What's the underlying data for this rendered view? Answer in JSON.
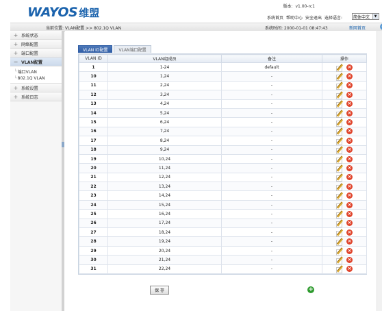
{
  "brand": {
    "logo_en": "WAYOS",
    "logo_cn": "维盟"
  },
  "header": {
    "version_label": "版本:",
    "version_value": "v1.00-rc1",
    "links": [
      "系统首页",
      "帮助中心",
      "安全退出",
      "选择语言:"
    ],
    "language_selected": "简体中文"
  },
  "breadcrumb": {
    "text": "当前位置: VLAN配置 >> 802.1Q VLAN",
    "time_label": "系统时间:",
    "time_value": "2000-01-01 08:47:43",
    "home_link": "新网首页"
  },
  "sidebar": {
    "items": [
      {
        "sign": "+",
        "label": "系统状态"
      },
      {
        "sign": "+",
        "label": "网络配置"
      },
      {
        "sign": "+",
        "label": "端口配置"
      },
      {
        "sign": "−",
        "label": "VLAN配置"
      },
      {
        "sign": "+",
        "label": "系统设置"
      },
      {
        "sign": "+",
        "label": "系统日志"
      }
    ],
    "sub_items": [
      {
        "tree": "└",
        "label": "端口VLAN"
      },
      {
        "tree": "└",
        "label": "802.1Q VLAN"
      }
    ]
  },
  "tabs": [
    "VLAN ID配置",
    "VLAN端口配置"
  ],
  "table": {
    "headers": [
      "VLAN ID",
      "VLAN组成员",
      "备注",
      "操作"
    ],
    "rows": [
      {
        "id": "1",
        "members": "1-24",
        "note": "default"
      },
      {
        "id": "10",
        "members": "1,24",
        "note": "-"
      },
      {
        "id": "11",
        "members": "2,24",
        "note": "-"
      },
      {
        "id": "12",
        "members": "3,24",
        "note": "-"
      },
      {
        "id": "13",
        "members": "4,24",
        "note": "-"
      },
      {
        "id": "14",
        "members": "5,24",
        "note": "-"
      },
      {
        "id": "15",
        "members": "6,24",
        "note": "-"
      },
      {
        "id": "16",
        "members": "7,24",
        "note": "-"
      },
      {
        "id": "17",
        "members": "8,24",
        "note": "-"
      },
      {
        "id": "18",
        "members": "9,24",
        "note": "-"
      },
      {
        "id": "19",
        "members": "10,24",
        "note": "-"
      },
      {
        "id": "20",
        "members": "11,24",
        "note": "-"
      },
      {
        "id": "21",
        "members": "12,24",
        "note": "-"
      },
      {
        "id": "22",
        "members": "13,24",
        "note": "-"
      },
      {
        "id": "23",
        "members": "14,24",
        "note": "-"
      },
      {
        "id": "24",
        "members": "15,24",
        "note": "-"
      },
      {
        "id": "25",
        "members": "16,24",
        "note": "-"
      },
      {
        "id": "26",
        "members": "17,24",
        "note": "-"
      },
      {
        "id": "27",
        "members": "18,24",
        "note": "-"
      },
      {
        "id": "28",
        "members": "19,24",
        "note": "-"
      },
      {
        "id": "29",
        "members": "20,24",
        "note": "-"
      },
      {
        "id": "30",
        "members": "21,24",
        "note": "-"
      },
      {
        "id": "31",
        "members": "22,24",
        "note": "-"
      }
    ]
  },
  "actions": {
    "save_label": "保 存"
  },
  "colors": {
    "brand": "#1b63ad",
    "tab_active": "#2f5da5",
    "delete": "#e0462e",
    "add": "#2f9b2f",
    "edit": "#e0b13b"
  }
}
